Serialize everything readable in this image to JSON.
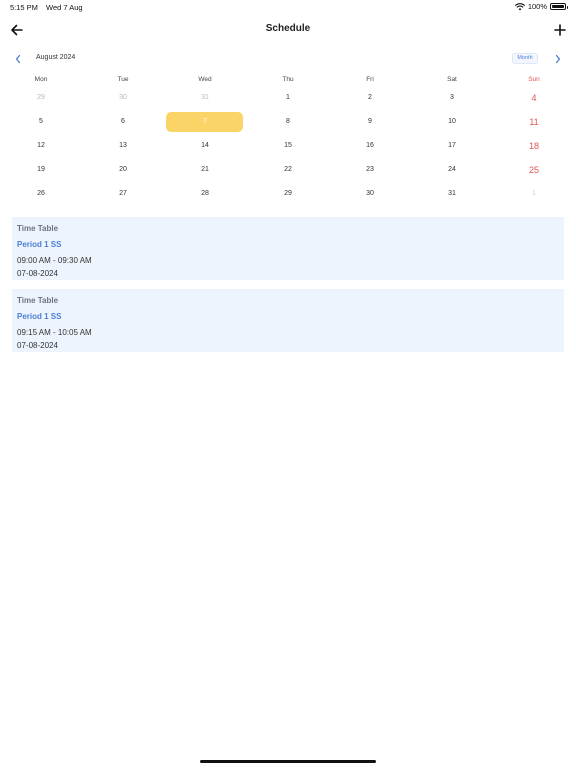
{
  "status_bar": {
    "time": "5:15 PM",
    "date": "Wed 7 Aug",
    "battery": "100%"
  },
  "header": {
    "title": "Schedule",
    "back_icon": "arrow-left-icon",
    "add_icon": "plus-icon"
  },
  "calendar": {
    "month_label": "August 2024",
    "view_label": "Month",
    "weekdays": [
      "Mon",
      "Tue",
      "Wed",
      "Thu",
      "Fri",
      "Sat",
      "Sun"
    ],
    "weeks": [
      [
        "29",
        "30",
        "31",
        "1",
        "2",
        "3",
        "4"
      ],
      [
        "5",
        "6",
        "7",
        "8",
        "9",
        "10",
        "11"
      ],
      [
        "12",
        "13",
        "14",
        "15",
        "16",
        "17",
        "18"
      ],
      [
        "19",
        "20",
        "21",
        "22",
        "23",
        "24",
        "25"
      ],
      [
        "26",
        "27",
        "28",
        "29",
        "30",
        "31",
        "1"
      ]
    ],
    "selected_day": "7",
    "colors": {
      "selected": "#fbd468",
      "sunday": "#e15555",
      "accent": "#4a7fd4"
    }
  },
  "events": [
    {
      "type": "Time Table",
      "title": "Period 1 SS",
      "time": "09:00 AM - 09:30 AM",
      "date": "07-08-2024"
    },
    {
      "type": "Time Table",
      "title": "Period 1 SS",
      "time": "09:15 AM - 10:05 AM",
      "date": "07-08-2024"
    }
  ]
}
